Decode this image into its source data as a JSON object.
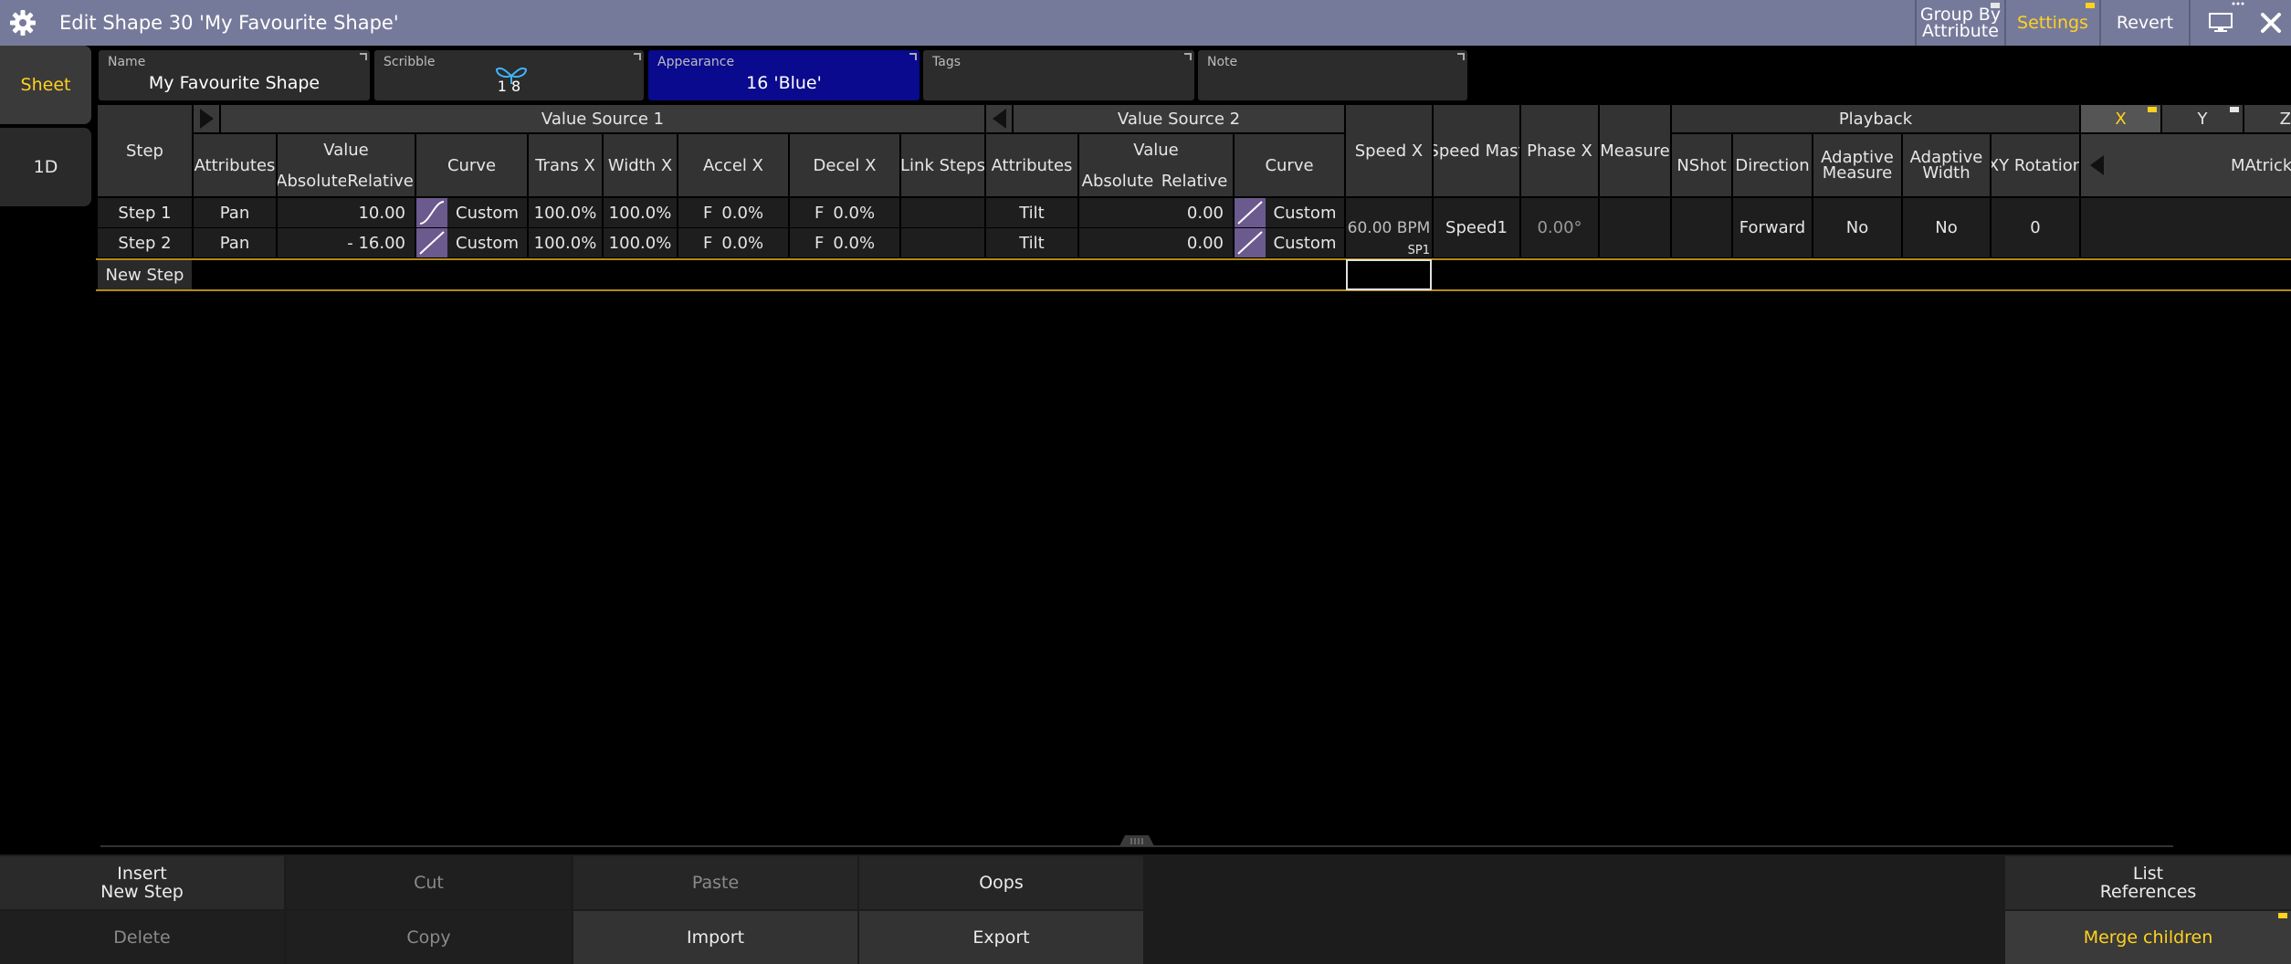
{
  "window": {
    "title": "Edit Shape 30 'My Favourite Shape'",
    "icons": {
      "settings": "gear-icon",
      "display": "monitor-icon",
      "close": "close-icon"
    }
  },
  "toolbar": {
    "group_by_line1": "Group By",
    "group_by_line2": "Attribute",
    "settings": "Settings",
    "revert": "Revert"
  },
  "side_tabs": {
    "sheet": "Sheet",
    "one_d": "1D"
  },
  "fields": {
    "name": {
      "label": "Name",
      "value": "My Favourite Shape"
    },
    "scribble": {
      "label": "Scribble",
      "value": "1 8"
    },
    "appearance": {
      "label": "Appearance",
      "value": "16 'Blue'"
    },
    "tags": {
      "label": "Tags",
      "value": ""
    },
    "note": {
      "label": "Note",
      "value": ""
    }
  },
  "grid": {
    "groups": {
      "value_source_1": "Value Source 1",
      "value_source_2": "Value Source 2",
      "playback": "Playback"
    },
    "headers": {
      "step": "Step",
      "attributes": "Attributes",
      "value": "Value",
      "absolute": "Absolute",
      "relative": "Relative",
      "curve": "Curve",
      "trans_x": "Trans X",
      "width_x": "Width X",
      "accel_x": "Accel X",
      "decel_x": "Decel X",
      "link_steps": "Link Steps",
      "attributes2": "Attributes",
      "value2": "Value",
      "absolute2": "Absolute",
      "relative2": "Relative",
      "curve2": "Curve",
      "speed_x": "Speed X",
      "speed_mast": "Speed Mast",
      "phase_x": "Phase X",
      "measure": "Measure",
      "nshot": "NShot",
      "direction": "Direction",
      "adaptive_measure_1": "Adaptive",
      "adaptive_measure_2": "Measure",
      "adaptive_width_1": "Adaptive",
      "adaptive_width_2": "Width",
      "xy_rotation": "XY Rotation",
      "axis_x": "X",
      "axis_y": "Y",
      "axis_z": "Z",
      "matricks": "MAtricks"
    },
    "rows": [
      {
        "step": "Step 1",
        "attr1": "Pan",
        "rel1": "10.00",
        "curve1": "Custom",
        "trans": "100.0%",
        "width": "100.0%",
        "accel_f": "F",
        "accel": "0.0%",
        "decel_f": "F",
        "decel": "0.0%",
        "attr2": "Tilt",
        "rel2": "0.00",
        "curve2": "Custom"
      },
      {
        "step": "Step 2",
        "attr1": "Pan",
        "rel1": "- 16.00",
        "curve1": "Custom",
        "trans": "100.0%",
        "width": "100.0%",
        "accel_f": "F",
        "accel": "0.0%",
        "decel_f": "F",
        "decel": "0.0%",
        "attr2": "Tilt",
        "rel2": "0.00",
        "curve2": "Custom"
      }
    ],
    "playback": {
      "speed_x": "60.00 BPM",
      "speed_tag": "SP1",
      "speed_mast": "Speed1",
      "phase_x": "0.00°",
      "direction": "Forward",
      "adaptive_measure": "No",
      "adaptive_width": "No",
      "xy_rotation": "0"
    },
    "new_step": "New Step"
  },
  "bottom": {
    "insert_line1": "Insert",
    "insert_line2": "New Step",
    "cut": "Cut",
    "paste": "Paste",
    "oops": "Oops",
    "list_line1": "List",
    "list_line2": "References",
    "delete": "Delete",
    "copy": "Copy",
    "import": "Import",
    "export": "Export",
    "merge": "Merge children"
  },
  "colors": {
    "titlebar": "#767a9a",
    "accent": "#ffd21f",
    "appearance": "#0a0a8e",
    "curve": "#6a5a8e"
  }
}
